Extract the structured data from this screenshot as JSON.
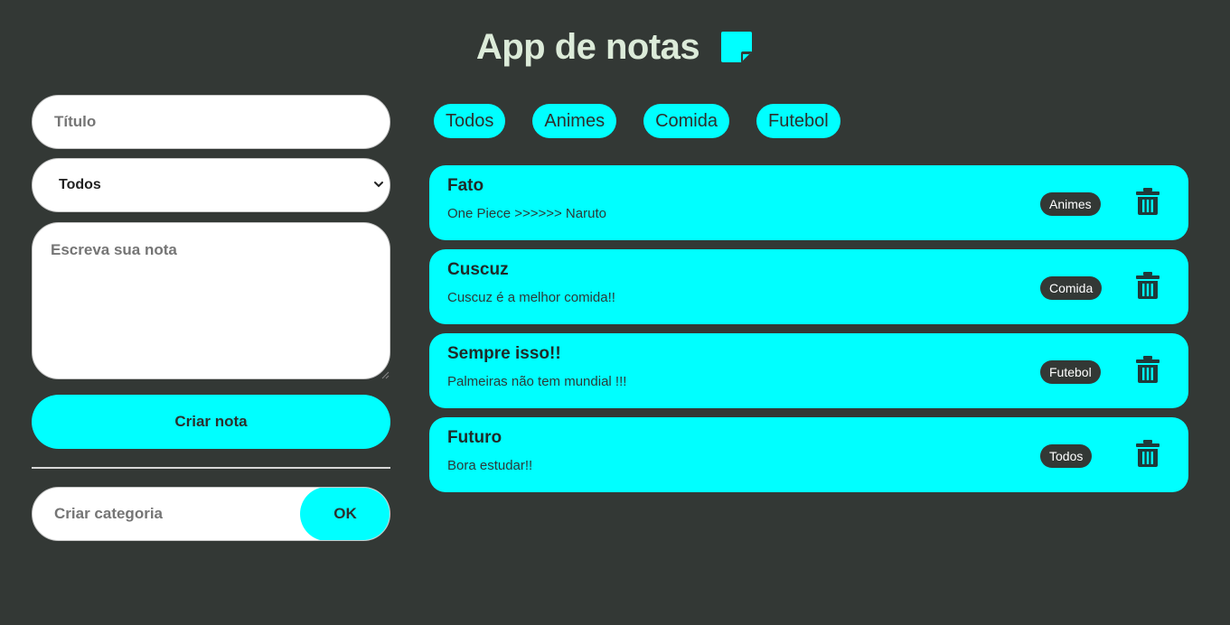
{
  "header": {
    "title": "App de notas",
    "icon": "sticky-note-icon"
  },
  "colors": {
    "background": "#333835",
    "accent": "#00ffff",
    "title": "#dcebd9",
    "badge": "#333835"
  },
  "form": {
    "title_placeholder": "Título",
    "category_selected": "Todos",
    "note_placeholder": "Escreva sua nota",
    "create_label": "Criar nota",
    "new_category_placeholder": "Criar categoria",
    "ok_label": "OK"
  },
  "filters": [
    "Todos",
    "Animes",
    "Comida",
    "Futebol"
  ],
  "notes": [
    {
      "title": "Fato",
      "body": "One Piece >>>>>> Naruto",
      "category": "Animes"
    },
    {
      "title": "Cuscuz",
      "body": "Cuscuz é a melhor comida!!",
      "category": "Comida"
    },
    {
      "title": "Sempre isso!!",
      "body": "Palmeiras não tem mundial !!!",
      "category": "Futebol"
    },
    {
      "title": "Futuro",
      "body": "Bora estudar!!",
      "category": "Todos"
    }
  ]
}
